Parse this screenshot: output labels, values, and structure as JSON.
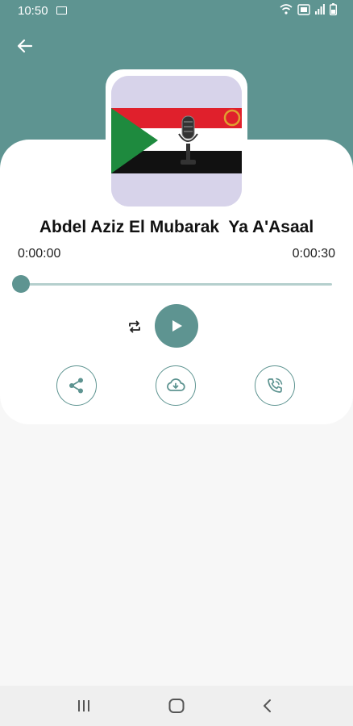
{
  "status_bar": {
    "time": "10:50"
  },
  "header": {
    "back_icon": "arrow-left-icon"
  },
  "player": {
    "title": "Abdel Aziz El Mubarak  Ya A'Asaal",
    "current_time": "0:00:00",
    "total_time": "0:00:30",
    "progress": 0,
    "accent_color": "#5e9491"
  },
  "actions": {
    "share_icon": "share-icon",
    "download_icon": "cloud-download-icon",
    "call_icon": "phone-call-icon"
  }
}
